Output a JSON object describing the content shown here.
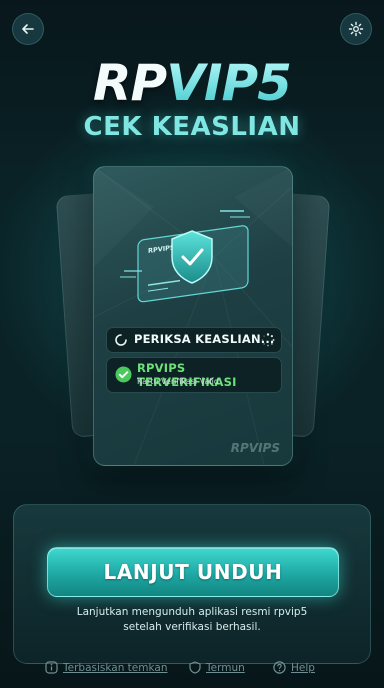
{
  "header": {
    "back_icon": "arrow-left-icon",
    "settings_icon": "gear-icon"
  },
  "brand": {
    "part1": "RP",
    "part2": "VIP5"
  },
  "subtitle": "CEK KEASLIAN",
  "card": {
    "status_checking": "PERIKSA KEASLIAN...",
    "status_verified": "RPVIPS TERVERIFIKASI",
    "status_verified_sub": "Kartu Verifikasi Valid",
    "mini_card_label": "RPVIPS",
    "watermark": "RPVIPS"
  },
  "cta": {
    "label": "LANJUT UNDUH",
    "description_line1": "Lanjutkan mengunduh aplikasi resmi rpvip5",
    "description_line2": "setelah verifikasi berhasil."
  },
  "footer": {
    "links": [
      {
        "label": "Terbasiskan temkan",
        "icon": "info-icon"
      },
      {
        "label": "Termun",
        "icon": "shield-icon"
      },
      {
        "label": "Help",
        "icon": "question-icon"
      }
    ]
  },
  "colors": {
    "accent": "#3fd8cf",
    "brand_highlight": "#6fe3e3",
    "verified_green": "#6ee07a",
    "background": "#0a2226"
  }
}
